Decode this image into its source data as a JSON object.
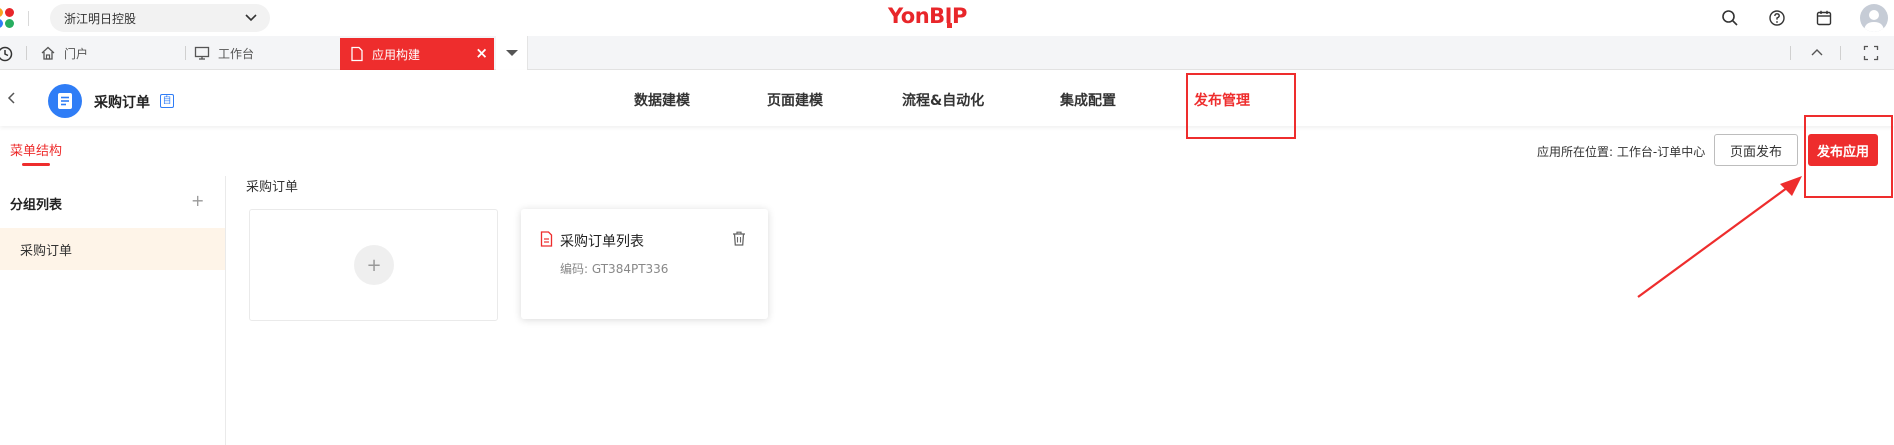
{
  "topbar": {
    "org_name": "浙江明日控股",
    "brand": "YonBIP"
  },
  "tabs": {
    "portal": "门户",
    "workbench": "工作台",
    "active": "应用构建",
    "close": "×"
  },
  "app_header": {
    "title": "采购订单",
    "badge": "自",
    "nav": [
      "数据建模",
      "页面建模",
      "流程&自动化",
      "集成配置",
      "发布管理"
    ],
    "active_nav_index": 4
  },
  "subheader": {
    "tab": "菜单结构",
    "location": "应用所在位置: 工作台-订单中心",
    "page_publish": "页面发布",
    "publish_app": "发布应用"
  },
  "left_panel": {
    "title": "分组列表",
    "add": "+",
    "items": [
      "采购订单"
    ]
  },
  "content": {
    "section_title": "采购订单",
    "add": "+",
    "card": {
      "title": "采购订单列表",
      "code": "编码: GT384PT336"
    }
  },
  "colors": {
    "accent_red": "#ee2d2d",
    "app_icon_blue": "#2f7df6",
    "selected_item_bg": "#fef4e8"
  }
}
